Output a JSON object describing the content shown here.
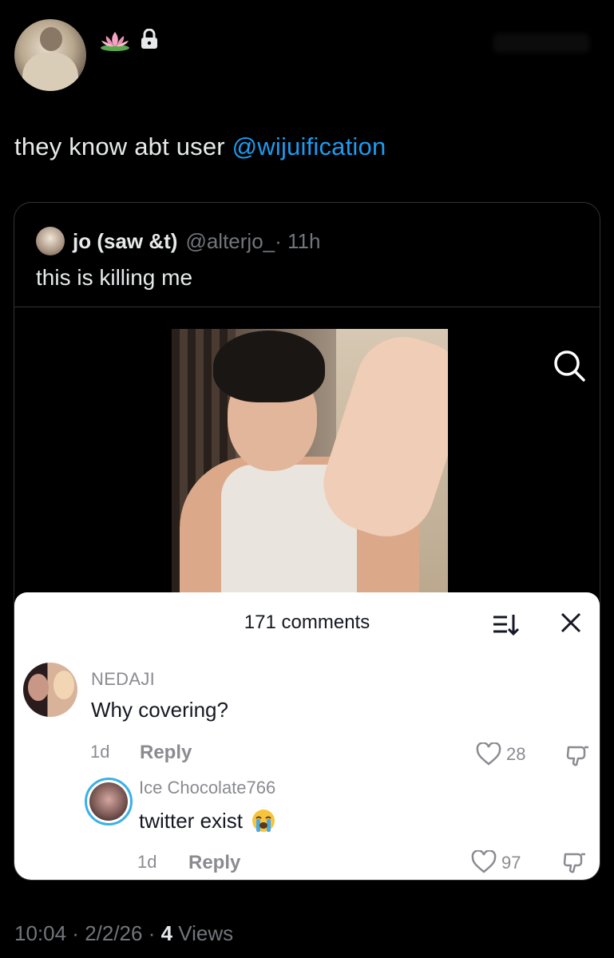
{
  "author": {
    "avatar_icon": "profile-photo",
    "badges": [
      "lotus-emoji",
      "lock-icon"
    ]
  },
  "tweet": {
    "text": "they know abt user ",
    "mention": "@wijuification"
  },
  "quoted_tweet": {
    "name": "jo (saw &t)",
    "handle": "@alterjo_",
    "time": "· 11h",
    "text": "this is killing me"
  },
  "embedded_screenshot": {
    "comments_title": "171 comments",
    "comments": [
      {
        "username": "NEDAJI",
        "text": "Why covering?",
        "age": "1d",
        "reply_label": "Reply",
        "likes": "28"
      }
    ],
    "replies": [
      {
        "username": "Ice Chocolate766",
        "text": "twitter exist",
        "emoji": "loudly-crying-face",
        "age": "1d",
        "reply_label": "Reply",
        "likes": "97"
      }
    ]
  },
  "footer": {
    "time": "10:04",
    "sep1": " · ",
    "date": "2/2/26",
    "sep2": " · ",
    "views_count": "4",
    "views_label": " Views"
  },
  "colors": {
    "background": "#000000",
    "mention": "#1d9bf0",
    "muted": "#71767b",
    "sheet": "#ffffff"
  }
}
